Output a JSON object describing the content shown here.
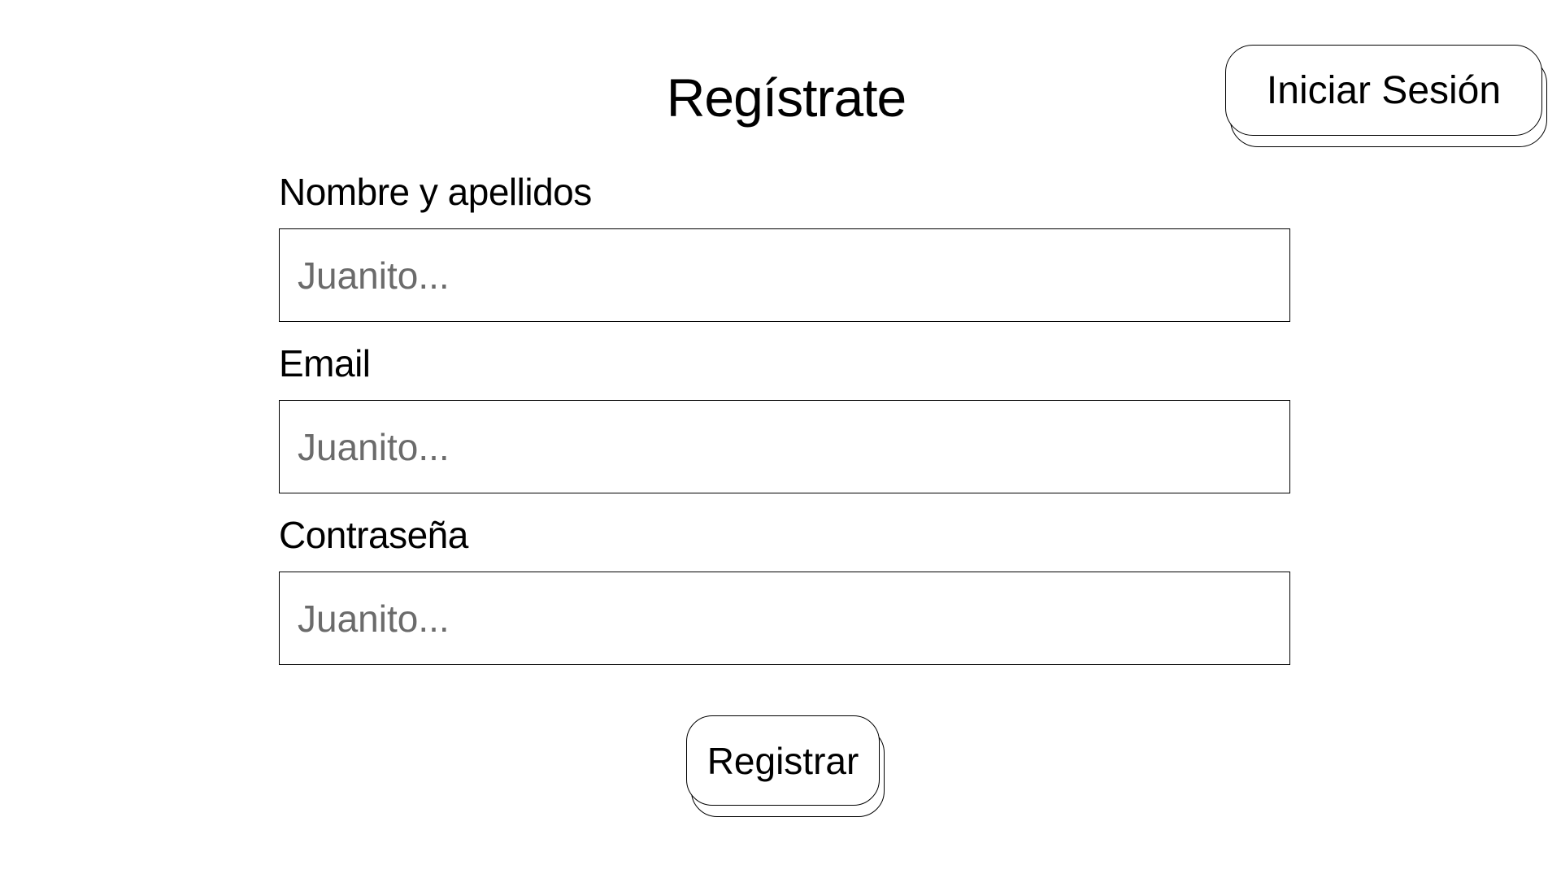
{
  "header": {
    "title": "Regístrate",
    "login_button": "Iniciar Sesión"
  },
  "form": {
    "fields": [
      {
        "label": "Nombre y apellidos",
        "placeholder": "Juanito...",
        "value": ""
      },
      {
        "label": "Email",
        "placeholder": "Juanito...",
        "value": ""
      },
      {
        "label": "Contraseña",
        "placeholder": "Juanito...",
        "value": ""
      }
    ],
    "submit_label": "Registrar"
  }
}
